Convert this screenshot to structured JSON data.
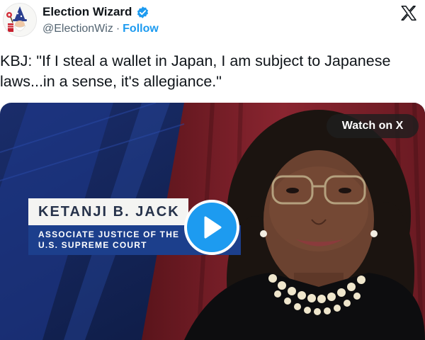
{
  "account": {
    "display_name": "Election Wizard",
    "handle": "@ElectionWiz",
    "separator": "·",
    "follow_label": "Follow",
    "verified": true
  },
  "icons": {
    "avatar": "wizard-gnome-avatar",
    "verified": "verified-badge-icon",
    "platform": "x-logo-icon",
    "play": "play-icon"
  },
  "tweet": {
    "text": "KBJ: \"If I steal a wallet in Japan, I am subject to Japanese laws...in a sense, it's allegiance.\""
  },
  "media": {
    "watch_label": "Watch on X",
    "chyron_name": "KETANJI B. JACK",
    "chyron_title_line1": "ASSOCIATE JUSTICE OF THE",
    "chyron_title_line2": "U.S. SUPREME COURT"
  },
  "colors": {
    "link": "#1d9bf0",
    "verified": "#1d9bf0",
    "chyron_blue": "#1c3f8c",
    "background_red": "#7a1f28",
    "background_blue": "#10204f"
  }
}
